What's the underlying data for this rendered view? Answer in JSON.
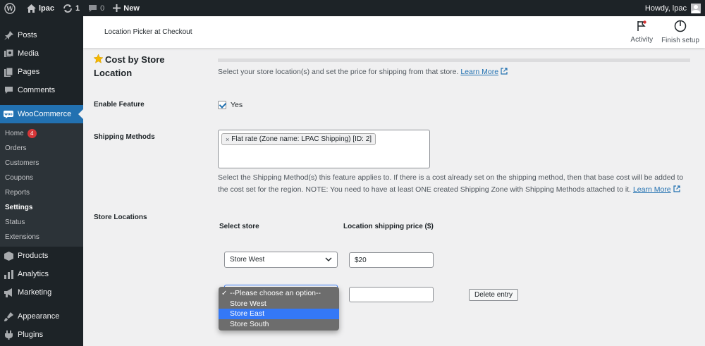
{
  "adminbar": {
    "site_name": "lpac",
    "updates_count": "1",
    "comments_count": "0",
    "new_label": "New",
    "howdy": "Howdy, lpac"
  },
  "sidebar": {
    "items_top": [
      {
        "label": "Posts",
        "icon": "pin-icon"
      },
      {
        "label": "Media",
        "icon": "media-icon"
      },
      {
        "label": "Pages",
        "icon": "pages-icon"
      },
      {
        "label": "Comments",
        "icon": "comment-icon"
      }
    ],
    "woocommerce": {
      "label": "WooCommerce",
      "icon_text": "woo"
    },
    "submenu": [
      {
        "label": "Home",
        "badge": "4"
      },
      {
        "label": "Orders"
      },
      {
        "label": "Customers"
      },
      {
        "label": "Coupons"
      },
      {
        "label": "Reports"
      },
      {
        "label": "Settings",
        "active": true
      },
      {
        "label": "Status"
      },
      {
        "label": "Extensions"
      }
    ],
    "items_bottom": [
      {
        "label": "Products",
        "icon": "products-icon"
      },
      {
        "label": "Analytics",
        "icon": "analytics-icon"
      },
      {
        "label": "Marketing",
        "icon": "marketing-icon"
      },
      {
        "label": "Appearance",
        "icon": "appearance-icon"
      },
      {
        "label": "Plugins",
        "icon": "plugins-icon"
      }
    ]
  },
  "header": {
    "title": "Location Picker at Checkout",
    "activity_label": "Activity",
    "finish_setup_label": "Finish setup"
  },
  "section": {
    "title": "Cost by Store Location",
    "description": "Select your store location(s) and set the price for shipping from that store.",
    "learn_more": "Learn More"
  },
  "enable_feature": {
    "label": "Enable Feature",
    "checkbox_label": "Yes",
    "checked": true
  },
  "shipping_methods": {
    "label": "Shipping Methods",
    "selected_tag": "Flat rate (Zone name: LPAC Shipping) [ID: 2]",
    "description_line1": "Select the Shipping Method(s) this feature applies to. If there is a cost already set on the shipping method, then that base cost will be added to",
    "description_line2": "the cost set for the region. NOTE: You need to have at least ONE created Shipping Zone with Shipping Methods attached to it.",
    "learn_more": "Learn More"
  },
  "store_locations": {
    "label": "Store Locations",
    "col_select_store": "Select store",
    "col_price": "Location shipping price ($)",
    "rows": [
      {
        "store": "Store West",
        "price": "$20"
      },
      {
        "store": "",
        "price": ""
      }
    ],
    "delete_label": "Delete entry"
  },
  "dropdown": {
    "options": [
      {
        "label": "--Please choose an option--",
        "checked": true
      },
      {
        "label": "Store West"
      },
      {
        "label": "Store East",
        "highlight": true
      },
      {
        "label": "Store South"
      }
    ]
  }
}
